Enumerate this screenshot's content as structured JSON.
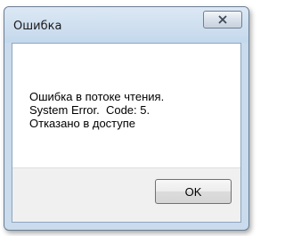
{
  "window": {
    "title": "Ошибка"
  },
  "icons": {
    "close": "close-icon"
  },
  "message": {
    "lines": [
      "Ошибка в потоке чтения.",
      "System Error.  Code: 5.",
      "Отказано в доступе"
    ]
  },
  "buttons": {
    "ok_label": "OK"
  },
  "colors": {
    "frame": "#c9dbec",
    "footer": "#f0f0f0",
    "client": "#ffffff"
  }
}
